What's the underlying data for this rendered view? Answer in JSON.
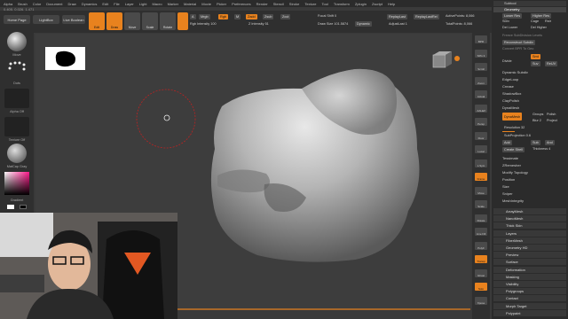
{
  "menu": [
    "Alpha",
    "Brush",
    "Color",
    "Document",
    "Draw",
    "Dynamics",
    "Edit",
    "File",
    "Layer",
    "Light",
    "Macro",
    "Marker",
    "Material",
    "Movie",
    "Picker",
    "Preferences",
    "Render",
    "Stencil",
    "Stroke",
    "Texture",
    "Tool",
    "Transform",
    "Zplugin",
    "Zscript",
    "Help"
  ],
  "coords": "0.405, 0.026, 1.471",
  "toolbar": {
    "home_page": "Home Page",
    "lightbox": "LightBox",
    "live_boolean": "Live Boolean",
    "tools": [
      "Edit",
      "Draw",
      "Move",
      "Scale",
      "Rotate"
    ],
    "a_label": "A",
    "mrgb": "Mrgb",
    "rgb": "Rgb",
    "m": "M",
    "zadd": "Zadd",
    "zsub": "Zsub",
    "zcut": "Zcut",
    "rgb_intensity": "Rgb Intensity 100",
    "z_intensity": "Z Intensity 51",
    "focal_shift": "Focal Shift 0",
    "draw_size": "Draw Size 101.5874",
    "dynamic": "Dynamic",
    "replay_last": "ReplayLast",
    "replay_last_rel": "ReplayLastRel",
    "adjust_last": "AdjustLast 1",
    "active_points": "ActivePoints: 8,066",
    "total_points": "TotalPoints: 8,066"
  },
  "left_shelf": {
    "brush_label": "Move",
    "stroke_label": "Dots",
    "alpha_label": "Alpha Off",
    "texture_label": "Texture Off",
    "material_label": "MatCap Gray",
    "gradient_label": "Gradient",
    "switch_color": "SwitchColor",
    "alternate": "Alternate"
  },
  "right_shelf": [
    "BPR",
    "SPix 3",
    "Scroll",
    "Zoom",
    "Actual",
    "AAHalf",
    "Persp",
    "Floor",
    "Local",
    "L.Sym",
    "Frame",
    "Move",
    "Scale",
    "Rotate",
    "Line Fill",
    "PolyF",
    "Transp",
    "Ghost",
    "Solo",
    "Xpose"
  ],
  "palette": {
    "header": "Subtool",
    "geometry": "Geometry",
    "lower_res": "Lower Res",
    "higher_res": "Higher Res",
    "sdiv": "SDiv",
    "cage": "Cage",
    "rstr": "Rstr",
    "del_lower": "Del Lower",
    "del_higher": "Del Higher",
    "freeze_subdivision": "Freeze SubDivision Levels",
    "reconstruct_subdiv": "Reconstruct Subdiv",
    "convert_bpr": "Convert BPR To Geo",
    "divide": "Divide",
    "smt": "Smt",
    "suv": "Suv",
    "rsuv": "ReUV",
    "dynamic_subdiv": "Dynamic Subdiv",
    "edge_loop": "EdgeLoop",
    "crease": "Crease",
    "shadowbox": "ShadowBox",
    "claypolish": "ClayPolish",
    "dynamesh": "DynaMesh",
    "dynamesh_btn": "DynaMesh",
    "groups": "Groups",
    "polish": "Polish",
    "blur": "Blur 2",
    "project": "Project",
    "resolution": "Resolution 32",
    "subprojection": "SubProjection 0.6",
    "add": "Add",
    "sub": "Sub",
    "and": "And",
    "create_shell": "Create Shell",
    "thickness": "Thickness 4",
    "items": [
      "Tessimate",
      "ZRemesher",
      "Modify Topology",
      "Position",
      "Size",
      "Sniper",
      "MeshIntegrity"
    ],
    "subpalettes": [
      "ArrayMesh",
      "NanoMesh",
      "Thick Skin",
      "Layers",
      "FiberMesh",
      "Geometry HD",
      "Preview",
      "Surface",
      "Deformation",
      "Masking",
      "Visibility",
      "Polygroups",
      "Contact",
      "Morph Target",
      "Polypaint"
    ]
  }
}
